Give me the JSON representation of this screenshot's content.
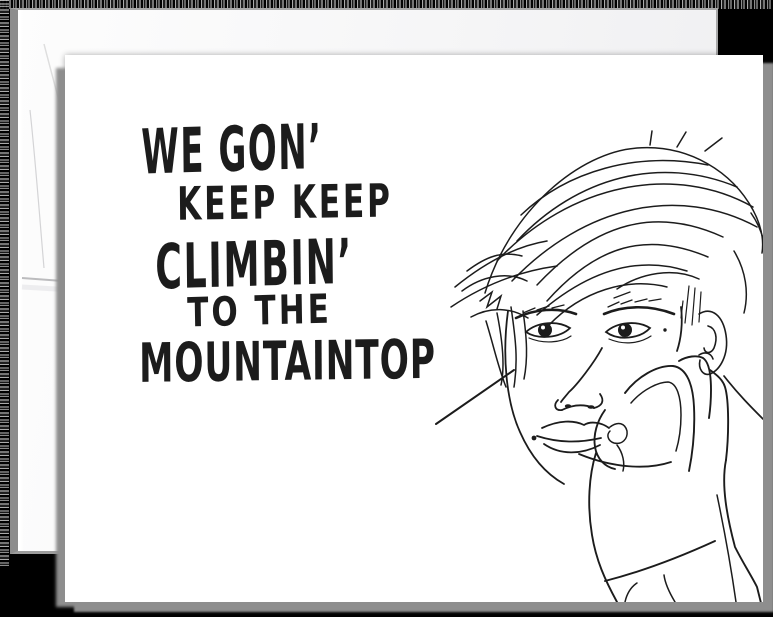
{
  "colors": {
    "background": "#000000",
    "envelope": "#f5f5f6",
    "envelope_edge": "#8c8c8c",
    "card": "#ffffff",
    "card_shadow": "#8e8e8e",
    "ink": "#1c1c1c"
  },
  "envelope": {
    "description": "blank white A2 envelope behind the card"
  },
  "card": {
    "lines": [
      "WE GON’",
      "KEEP KEEP",
      "CLIMBIN’",
      "TO THE",
      "MOUNTAINTOP"
    ],
    "illustration": "black line drawing of a young man with swept hair resting his chin on his fist"
  }
}
